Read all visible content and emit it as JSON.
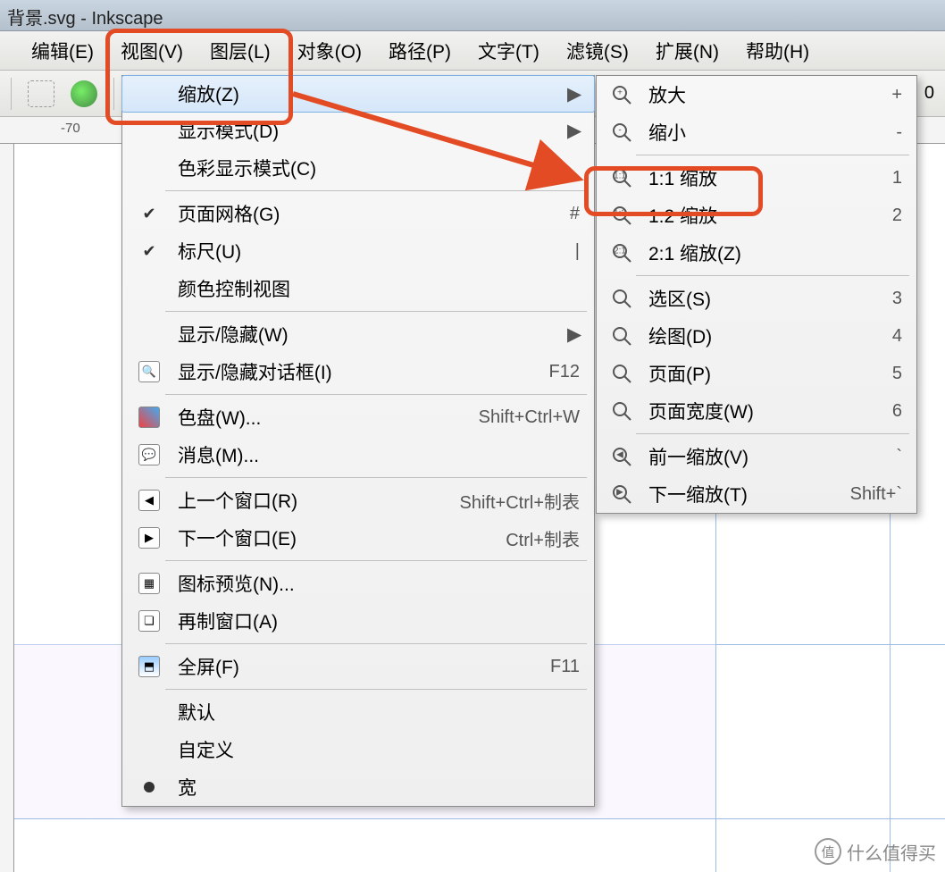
{
  "title": "背景.svg - Inkscape",
  "menubar": {
    "edit": "编辑(E)",
    "view": "视图(V)",
    "layer": "图层(L)",
    "object": "对象(O)",
    "path": "路径(P)",
    "text": "文字(T)",
    "filters": "滤镜(S)",
    "extensions": "扩展(N)",
    "help": "帮助(H)"
  },
  "toolbar_number": "0",
  "ruler_label": "-70",
  "view_menu": {
    "zoom": "缩放(Z)",
    "display_mode": "显示模式(D)",
    "color_display": "色彩显示模式(C)",
    "page_grid": "页面网格(G)",
    "page_grid_shortcut": "#",
    "rulers": "标尺(U)",
    "rulers_shortcut": "|",
    "color_control": "颜色控制视图",
    "show_hide": "显示/隐藏(W)",
    "dialogs": "显示/隐藏对话框(I)",
    "dialogs_shortcut": "F12",
    "swatches": "色盘(W)...",
    "swatches_shortcut": "Shift+Ctrl+W",
    "messages": "消息(M)...",
    "prev_window": "上一个窗口(R)",
    "prev_window_shortcut": "Shift+Ctrl+制表",
    "next_window": "下一个窗口(E)",
    "next_window_shortcut": "Ctrl+制表",
    "icon_preview": "图标预览(N)...",
    "dup_window": "再制窗口(A)",
    "fullscreen": "全屏(F)",
    "fullscreen_shortcut": "F11",
    "default": "默认",
    "custom": "自定义",
    "wide": "宽"
  },
  "zoom_menu": {
    "in": "放大",
    "in_sc": "+",
    "out": "缩小",
    "out_sc": "-",
    "z11": "1:1 缩放",
    "z11_sc": "1",
    "z12": "1:2 缩放",
    "z12_sc": "2",
    "z21": "2:1 缩放(Z)",
    "sel": "选区(S)",
    "sel_sc": "3",
    "draw": "绘图(D)",
    "draw_sc": "4",
    "page": "页面(P)",
    "page_sc": "5",
    "pw": "页面宽度(W)",
    "pw_sc": "6",
    "prev": "前一缩放(V)",
    "prev_sc": "`",
    "next": "下一缩放(T)",
    "next_sc": "Shift+`"
  },
  "watermark": "什么值得买"
}
